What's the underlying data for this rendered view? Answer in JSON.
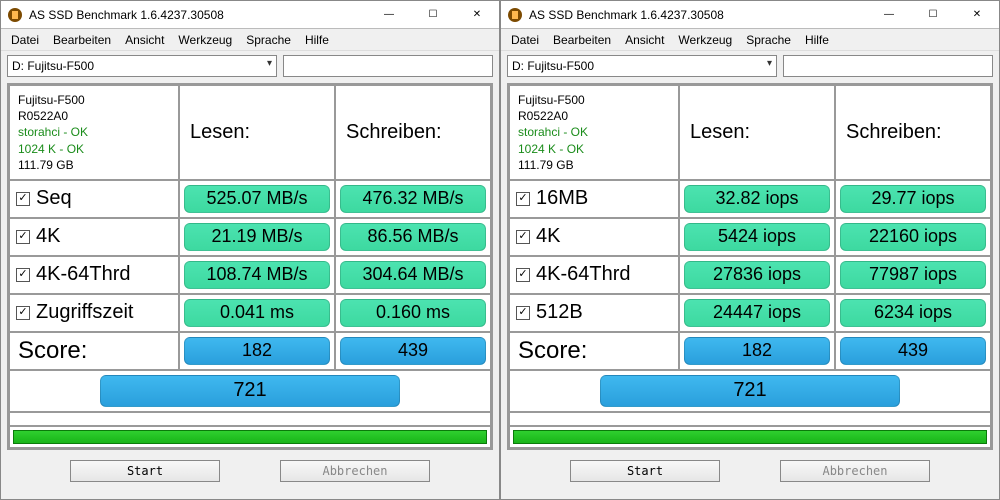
{
  "windows": [
    {
      "title": "AS SSD Benchmark 1.6.4237.30508",
      "menu": [
        "Datei",
        "Bearbeiten",
        "Ansicht",
        "Werkzeug",
        "Sprache",
        "Hilfe"
      ],
      "drive": "D: Fujitsu-F500",
      "info": {
        "model": "Fujitsu-F500",
        "fw": "R0522A0",
        "driver": "storahci - OK",
        "align": "1024 K - OK",
        "size": "111.79 GB"
      },
      "headers": {
        "read": "Lesen:",
        "write": "Schreiben:"
      },
      "rows": [
        {
          "label": "Seq",
          "read": "525.07 MB/s",
          "write": "476.32 MB/s"
        },
        {
          "label": "4K",
          "read": "21.19 MB/s",
          "write": "86.56 MB/s"
        },
        {
          "label": "4K-64Thrd",
          "read": "108.74 MB/s",
          "write": "304.64 MB/s"
        },
        {
          "label": "Zugriffszeit",
          "read": "0.041 ms",
          "write": "0.160 ms"
        }
      ],
      "score_label": "Score:",
      "score_read": "182",
      "score_write": "439",
      "score_total": "721",
      "buttons": {
        "start": "Start",
        "cancel": "Abbrechen"
      }
    },
    {
      "title": "AS SSD Benchmark 1.6.4237.30508",
      "menu": [
        "Datei",
        "Bearbeiten",
        "Ansicht",
        "Werkzeug",
        "Sprache",
        "Hilfe"
      ],
      "drive": "D: Fujitsu-F500",
      "info": {
        "model": "Fujitsu-F500",
        "fw": "R0522A0",
        "driver": "storahci - OK",
        "align": "1024 K - OK",
        "size": "111.79 GB"
      },
      "headers": {
        "read": "Lesen:",
        "write": "Schreiben:"
      },
      "rows": [
        {
          "label": "16MB",
          "read": "32.82 iops",
          "write": "29.77 iops"
        },
        {
          "label": "4K",
          "read": "5424 iops",
          "write": "22160 iops"
        },
        {
          "label": "4K-64Thrd",
          "read": "27836 iops",
          "write": "77987 iops"
        },
        {
          "label": "512B",
          "read": "24447 iops",
          "write": "6234 iops"
        }
      ],
      "score_label": "Score:",
      "score_read": "182",
      "score_write": "439",
      "score_total": "721",
      "buttons": {
        "start": "Start",
        "cancel": "Abbrechen"
      }
    }
  ]
}
